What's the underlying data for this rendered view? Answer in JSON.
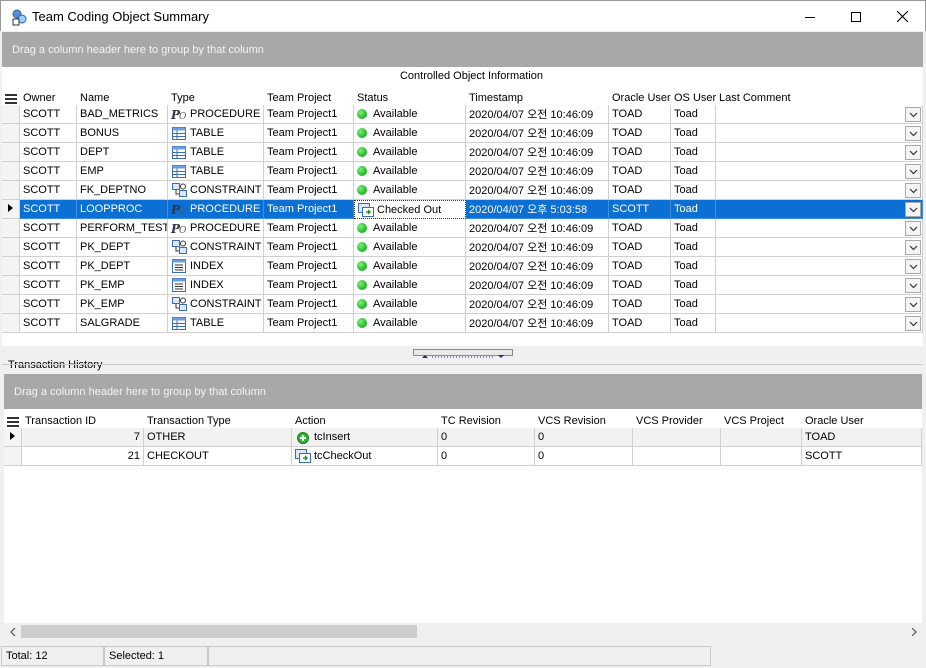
{
  "window": {
    "title": "Team Coding Object Summary",
    "icon": "team-coding-icon",
    "controls": [
      "minimize-icon",
      "maximize-icon",
      "close-icon"
    ]
  },
  "colors": {
    "selection": "#0c6fd3",
    "group_panel": "#a8a8a8",
    "status_available": "#1db41d"
  },
  "top_grid": {
    "group_panel_text": "Drag a column header here to group by that column",
    "band_title": "Controlled Object Information",
    "columns": [
      "Owner",
      "Name",
      "Type",
      "Team Project",
      "Status",
      "Timestamp",
      "Oracle User",
      "OS User",
      "Last Comment"
    ],
    "selected_row_index": 5,
    "rows": [
      {
        "owner": "SCOTT",
        "name": "BAD_METRICS",
        "type_icon": "procedure-icon",
        "type": "PROCEDURE",
        "project": "Team Project1",
        "status_icon": "available-icon",
        "status": "Available",
        "timestamp": "2020/04/07 오전 10:46:09",
        "oracle_user": "TOAD",
        "os_user": "Toad",
        "comment": ""
      },
      {
        "owner": "SCOTT",
        "name": "BONUS",
        "type_icon": "table-icon",
        "type": "TABLE",
        "project": "Team Project1",
        "status_icon": "available-icon",
        "status": "Available",
        "timestamp": "2020/04/07 오전 10:46:09",
        "oracle_user": "TOAD",
        "os_user": "Toad",
        "comment": ""
      },
      {
        "owner": "SCOTT",
        "name": "DEPT",
        "type_icon": "table-icon",
        "type": "TABLE",
        "project": "Team Project1",
        "status_icon": "available-icon",
        "status": "Available",
        "timestamp": "2020/04/07 오전 10:46:09",
        "oracle_user": "TOAD",
        "os_user": "Toad",
        "comment": ""
      },
      {
        "owner": "SCOTT",
        "name": "EMP",
        "type_icon": "table-icon",
        "type": "TABLE",
        "project": "Team Project1",
        "status_icon": "available-icon",
        "status": "Available",
        "timestamp": "2020/04/07 오전 10:46:09",
        "oracle_user": "TOAD",
        "os_user": "Toad",
        "comment": ""
      },
      {
        "owner": "SCOTT",
        "name": "FK_DEPTNO",
        "type_icon": "constraint-icon",
        "type": "CONSTRAINT",
        "project": "Team Project1",
        "status_icon": "available-icon",
        "status": "Available",
        "timestamp": "2020/04/07 오전 10:46:09",
        "oracle_user": "TOAD",
        "os_user": "Toad",
        "comment": ""
      },
      {
        "owner": "SCOTT",
        "name": "LOOPPROC",
        "type_icon": "procedure-icon",
        "type": "PROCEDURE",
        "project": "Team Project1",
        "status_icon": "checked-out-icon",
        "status": "Checked Out",
        "timestamp": "2020/04/07 오후 5:03:58",
        "oracle_user": "SCOTT",
        "os_user": "Toad",
        "comment": ""
      },
      {
        "owner": "SCOTT",
        "name": "PERFORM_TEST",
        "type_icon": "procedure-icon",
        "type": "PROCEDURE",
        "project": "Team Project1",
        "status_icon": "available-icon",
        "status": "Available",
        "timestamp": "2020/04/07 오전 10:46:09",
        "oracle_user": "TOAD",
        "os_user": "Toad",
        "comment": ""
      },
      {
        "owner": "SCOTT",
        "name": "PK_DEPT",
        "type_icon": "constraint-icon",
        "type": "CONSTRAINT",
        "project": "Team Project1",
        "status_icon": "available-icon",
        "status": "Available",
        "timestamp": "2020/04/07 오전 10:46:09",
        "oracle_user": "TOAD",
        "os_user": "Toad",
        "comment": ""
      },
      {
        "owner": "SCOTT",
        "name": "PK_DEPT",
        "type_icon": "index-icon",
        "type": "INDEX",
        "project": "Team Project1",
        "status_icon": "available-icon",
        "status": "Available",
        "timestamp": "2020/04/07 오전 10:46:09",
        "oracle_user": "TOAD",
        "os_user": "Toad",
        "comment": ""
      },
      {
        "owner": "SCOTT",
        "name": "PK_EMP",
        "type_icon": "index-icon",
        "type": "INDEX",
        "project": "Team Project1",
        "status_icon": "available-icon",
        "status": "Available",
        "timestamp": "2020/04/07 오전 10:46:09",
        "oracle_user": "TOAD",
        "os_user": "Toad",
        "comment": ""
      },
      {
        "owner": "SCOTT",
        "name": "PK_EMP",
        "type_icon": "constraint-icon",
        "type": "CONSTRAINT",
        "project": "Team Project1",
        "status_icon": "available-icon",
        "status": "Available",
        "timestamp": "2020/04/07 오전 10:46:09",
        "oracle_user": "TOAD",
        "os_user": "Toad",
        "comment": ""
      },
      {
        "owner": "SCOTT",
        "name": "SALGRADE",
        "type_icon": "table-icon",
        "type": "TABLE",
        "project": "Team Project1",
        "status_icon": "available-icon",
        "status": "Available",
        "timestamp": "2020/04/07 오전 10:46:09",
        "oracle_user": "TOAD",
        "os_user": "Toad",
        "comment": ""
      }
    ]
  },
  "history": {
    "panel_title": "Transaction History",
    "group_panel_text": "Drag a column header here to group by that column",
    "columns": [
      "Transaction ID",
      "Transaction Type",
      "Action",
      "TC Revision",
      "VCS Revision",
      "VCS Provider",
      "VCS Project",
      "Oracle User"
    ],
    "selected_row_index": 0,
    "rows": [
      {
        "id": "7",
        "type": "OTHER",
        "action_icon": "insert-icon",
        "action": "tcInsert",
        "tc_revision": "0",
        "vcs_revision": "0",
        "vcs_provider": "",
        "vcs_project": "",
        "oracle_user": "TOAD"
      },
      {
        "id": "21",
        "type": "CHECKOUT",
        "action_icon": "checkout-icon",
        "action": "tcCheckOut",
        "tc_revision": "0",
        "vcs_revision": "0",
        "vcs_provider": "",
        "vcs_project": "",
        "oracle_user": "SCOTT"
      }
    ],
    "scrollbar": {
      "position": 0
    }
  },
  "statusbar": {
    "total": "Total: 12",
    "selected": "Selected: 1"
  }
}
